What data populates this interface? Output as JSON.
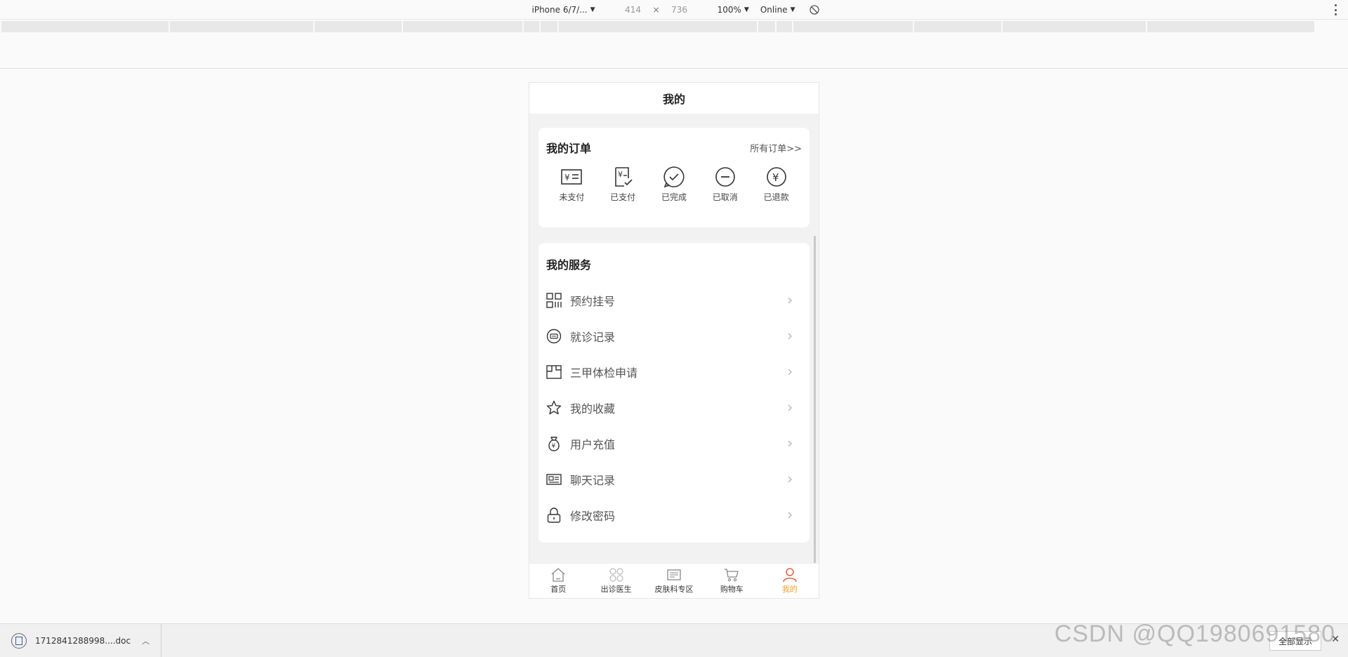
{
  "device_toolbar": {
    "device": "iPhone 6/7/...",
    "width": "414",
    "height": "736",
    "separator": "×",
    "zoom": "100%",
    "network": "Online"
  },
  "header": {
    "title": "我的"
  },
  "orders": {
    "title": "我的订单",
    "all_link": "所有订单>>",
    "items": [
      {
        "label": "未支付",
        "icon": "unpaid-icon"
      },
      {
        "label": "已支付",
        "icon": "paid-icon"
      },
      {
        "label": "已完成",
        "icon": "completed-icon"
      },
      {
        "label": "已取消",
        "icon": "cancelled-icon"
      },
      {
        "label": "已退款",
        "icon": "refunded-icon"
      }
    ]
  },
  "services": {
    "title": "我的服务",
    "items": [
      {
        "label": "预约挂号",
        "icon": "grid-icon"
      },
      {
        "label": "就诊记录",
        "icon": "record-icon"
      },
      {
        "label": "三甲体检申请",
        "icon": "checkup-icon"
      },
      {
        "label": "我的收藏",
        "icon": "star-icon"
      },
      {
        "label": "用户充值",
        "icon": "money-bag-icon"
      },
      {
        "label": "聊天记录",
        "icon": "chat-card-icon"
      },
      {
        "label": "修改密码",
        "icon": "lock-icon"
      }
    ]
  },
  "tabbar": {
    "items": [
      {
        "label": "首页",
        "icon": "home-icon"
      },
      {
        "label": "出诊医生",
        "icon": "doctor-icon"
      },
      {
        "label": "皮肤科专区",
        "icon": "dermatology-icon"
      },
      {
        "label": "购物车",
        "icon": "cart-icon"
      },
      {
        "label": "我的",
        "icon": "user-icon",
        "active": true
      }
    ]
  },
  "download": {
    "file_name": "1712841288998....doc",
    "show_all": "全部显示",
    "close": "✕"
  },
  "watermark": "CSDN @QQ1980691580",
  "colors": {
    "accent": "#f0a020",
    "active_icon": "#e8603c"
  }
}
